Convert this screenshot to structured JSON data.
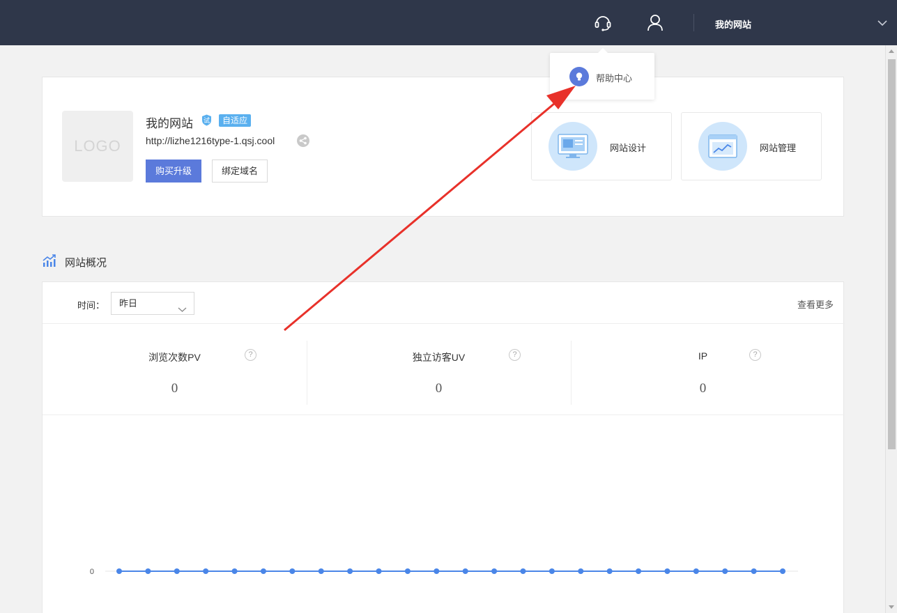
{
  "topbar": {
    "site_name": "我的网站",
    "icons": [
      "headset-icon",
      "user-icon",
      "chevron-down-icon"
    ]
  },
  "popup": {
    "label": "帮助中心",
    "icon": "bulb-icon"
  },
  "site": {
    "logo_text": "LOGO",
    "title": "我的网站",
    "trial_badge": "试",
    "adaptive_badge": "自适应",
    "url": "http://lizhe1216type-1.qsj.cool",
    "buy_button": "购买升级",
    "bind_domain_button": "绑定域名",
    "quick_links": [
      {
        "label": "网站设计",
        "icon": "monitor-design-icon"
      },
      {
        "label": "网站管理",
        "icon": "browser-chart-icon"
      }
    ]
  },
  "overview": {
    "title": "网站概况",
    "time_label": "时间：",
    "time_selected": "昨日",
    "more_link": "查看更多",
    "stats": [
      {
        "label": "浏览次数PV",
        "value": "0"
      },
      {
        "label": "独立访客UV",
        "value": "0"
      },
      {
        "label": "IP",
        "value": "0"
      }
    ],
    "help_mark": "?"
  },
  "colors": {
    "topbar": "#2f374a",
    "primary": "#5b7adb",
    "badge": "#5ab0ef",
    "line": "#4a86e8",
    "annotation_arrow": "#e8312a"
  },
  "chart_data": {
    "type": "line",
    "series": [
      {
        "values": [
          0,
          0,
          0,
          0,
          0,
          0,
          0,
          0,
          0,
          0,
          0,
          0,
          0,
          0,
          0,
          0,
          0,
          0,
          0,
          0,
          0,
          0,
          0,
          0
        ]
      }
    ],
    "y_tick_labels": [
      "0"
    ]
  }
}
